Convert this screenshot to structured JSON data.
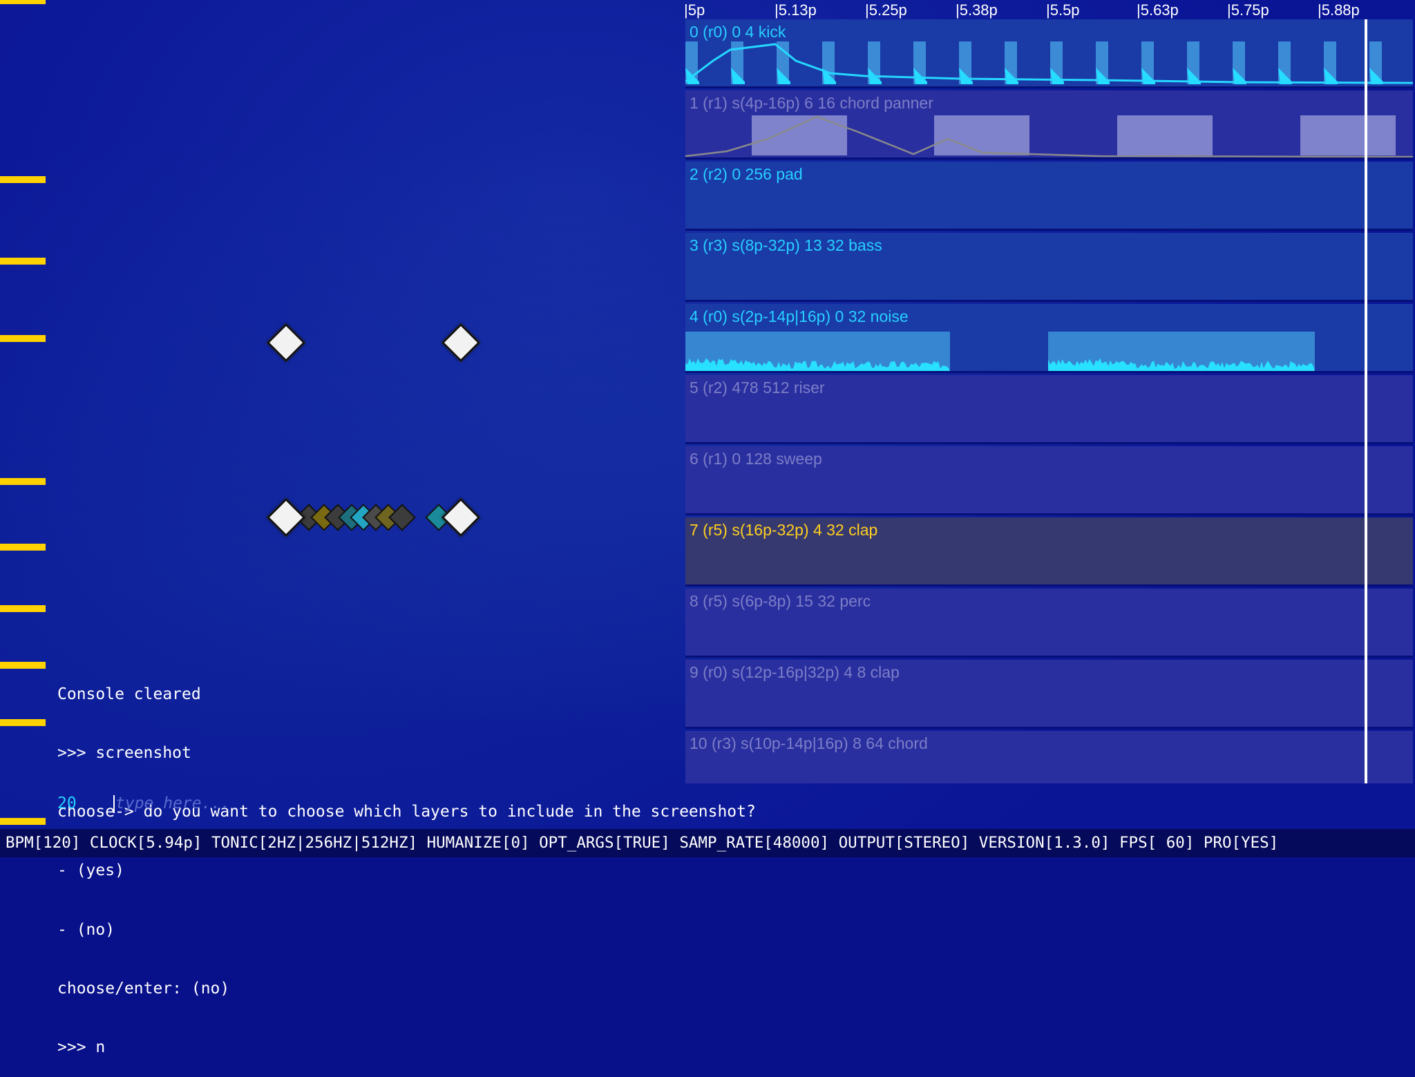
{
  "ruler": {
    "labels": [
      "|5p",
      "|5.13p",
      "|5.25p",
      "|5.38p",
      "|5.5p",
      "|5.63p",
      "|5.75p",
      "|5.88p"
    ]
  },
  "tracks": [
    {
      "label": "0 (r0) 0 4 kick",
      "state": "active"
    },
    {
      "label": "1 (r1) s(4p-16p) 6 16 chord panner",
      "state": "muted"
    },
    {
      "label": "2 (r2) 0 256 pad",
      "state": "active"
    },
    {
      "label": "3 (r3) s(8p-32p) 13 32 bass",
      "state": "active"
    },
    {
      "label": "4 (r0) s(2p-14p|16p) 0 32 noise",
      "state": "active"
    },
    {
      "label": "5 (r2) 478 512 riser",
      "state": "muted"
    },
    {
      "label": "6 (r1) 0 128 sweep",
      "state": "muted"
    },
    {
      "label": "7 (r5) s(16p-32p) 4 32 clap",
      "state": "selected"
    },
    {
      "label": "8 (r5) s(6p-8p) 15 32 perc",
      "state": "muted"
    },
    {
      "label": "9 (r0) s(12p-16p|32p) 4 8 clap",
      "state": "muted"
    },
    {
      "label": "10 (r3) s(10p-14p|16p) 8 64 chord",
      "state": "muted"
    }
  ],
  "console": {
    "lines": [
      "Console cleared",
      ">>> screenshot",
      "choose-> do you want to choose which layers to include in the screenshot?",
      "- (yes)",
      "- (no)",
      "choose/enter: (no)",
      ">>> n"
    ],
    "line_number": "20",
    "placeholder": "type here..."
  },
  "status": "BPM[120] CLOCK[5.94p] TONIC[2HZ|256HZ|512HZ] HUMANIZE[0] OPT_ARGS[TRUE] SAMP_RATE[48000] OUTPUT[STEREO] VERSION[1.3.0] FPS[ 60] PRO[YES]",
  "colors": {
    "background": "#0a1596",
    "active_label": "#27d0ff",
    "muted_label": "#7c7ec6",
    "selected_label": "#ffce1f",
    "tick": "#ffd200"
  }
}
